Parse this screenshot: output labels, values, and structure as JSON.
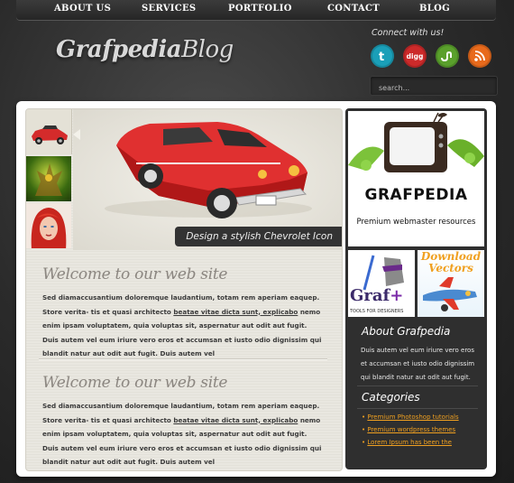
{
  "nav": {
    "items": [
      {
        "label": "ABOUT US"
      },
      {
        "label": "SERVICES"
      },
      {
        "label": "PORTFOLIO"
      },
      {
        "label": "CONTACT"
      },
      {
        "label": "BLOG"
      }
    ]
  },
  "header": {
    "logo_bold": "Grafpedia",
    "logo_light": "Blog",
    "connect_label": "Connect with us!",
    "social": [
      {
        "icon": "twitter-icon",
        "color": "#1a9fb8"
      },
      {
        "icon": "digg-icon",
        "color": "#cc2a2a",
        "text": "digg"
      },
      {
        "icon": "stumbleupon-icon",
        "color": "#5aa02c"
      },
      {
        "icon": "rss-icon",
        "color": "#e86a1c"
      }
    ],
    "search_placeholder": "search..."
  },
  "slider": {
    "caption": "Design a stylish Chevrolet Icon",
    "thumbs": [
      "red-car-thumbnail",
      "dragon-thumbnail",
      "redhead-woman-thumbnail"
    ]
  },
  "articles": [
    {
      "title": "Welcome to our web site",
      "text_before": "Sed diamaccusantium doloremque laudantium, totam rem aperiam eaquep. Store verita- tis et quasi architecto ",
      "link": "beatae vitae dicta sunt, explicabo",
      "text_after": " nemo enim ipsam voluptatem, quia voluptas sit, aspernatur aut odit aut fugit. Duis autem vel eum iriure vero eros et accumsan et iusto odio dignissim qui blandit natur aut odit aut fugit. Duis autem vel"
    },
    {
      "title": "Welcome to our web site",
      "text_before": "Sed diamaccusantium doloremque laudantium, totam rem aperiam eaquep. Store verita- tis et quasi architecto ",
      "link": "beatae vitae dicta sunt, explicabo",
      "text_after": " nemo enim ipsam voluptatem, quia voluptas sit, aspernatur aut odit aut fugit. Duis autem vel eum iriure vero eros et accumsan et iusto odio dignissim qui blandit natur aut odit aut fugit. Duis autem vel"
    }
  ],
  "sidebar": {
    "ad_brand": "GRAFPEDIA",
    "ad_tagline": "Premium webmaster resources",
    "ad_graf_brand": "Graf",
    "ad_graf_plus": "+",
    "ad_graf_tag": "TOOLS FOR DESIGNERS",
    "ad_download": "Download",
    "ad_vectors": "Vectors",
    "about_title": "About Grafpedia",
    "about_text": "Duis autem vel eum iriure vero eros et accumsan et iusto odio dignissim qui blandit natur aut odit aut fugit.",
    "categories_title": "Categories",
    "categories": [
      {
        "label": "Premium Photoshop tutorials"
      },
      {
        "label": "Premium wordpress themes"
      },
      {
        "label": "Lorem Ipsum has been the"
      }
    ]
  }
}
